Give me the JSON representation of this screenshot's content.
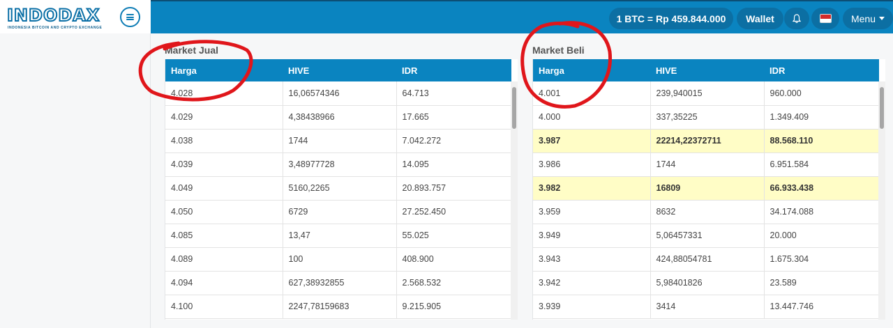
{
  "header": {
    "logo_text": "INDODAX",
    "logo_tagline": "INDONESIA BITCOIN AND CRYPTO EXCHANGE",
    "btc_rate": "1 BTC = Rp 459.844.000",
    "wallet_label": "Wallet",
    "menu_label": "Menu",
    "icons": [
      "hamburger-icon",
      "bell-icon",
      "indonesia-flag-icon",
      "caret-down-icon"
    ],
    "colors": {
      "primary": "#0a84c0",
      "pill": "#0c6fa3",
      "highlight": "#fffdc6",
      "annotation": "#e0161b"
    }
  },
  "sell": {
    "title": "Market Jual",
    "columns": [
      "Harga",
      "HIVE",
      "IDR"
    ],
    "rows": [
      [
        "4.028",
        "16,06574346",
        "64.713"
      ],
      [
        "4.029",
        "4,38438966",
        "17.665"
      ],
      [
        "4.038",
        "1744",
        "7.042.272"
      ],
      [
        "4.039",
        "3,48977728",
        "14.095"
      ],
      [
        "4.049",
        "5160,2265",
        "20.893.757"
      ],
      [
        "4.050",
        "6729",
        "27.252.450"
      ],
      [
        "4.085",
        "13,47",
        "55.025"
      ],
      [
        "4.089",
        "100",
        "408.900"
      ],
      [
        "4.094",
        "627,38932855",
        "2.568.532"
      ],
      [
        "4.100",
        "2247,78159683",
        "9.215.905"
      ]
    ]
  },
  "buy": {
    "title": "Market Beli",
    "columns": [
      "Harga",
      "HIVE",
      "IDR"
    ],
    "rows": [
      [
        "4.001",
        "239,940015",
        "960.000"
      ],
      [
        "4.000",
        "337,35225",
        "1.349.409"
      ],
      [
        "3.987",
        "22214,22372711",
        "88.568.110"
      ],
      [
        "3.986",
        "1744",
        "6.951.584"
      ],
      [
        "3.982",
        "16809",
        "66.933.438"
      ],
      [
        "3.959",
        "8632",
        "34.174.088"
      ],
      [
        "3.949",
        "5,06457331",
        "20.000"
      ],
      [
        "3.943",
        "424,88054781",
        "1.675.304"
      ],
      [
        "3.942",
        "5,98401826",
        "23.589"
      ],
      [
        "3.939",
        "3414",
        "13.447.746"
      ]
    ],
    "highlighted_rows": [
      2,
      4
    ]
  }
}
